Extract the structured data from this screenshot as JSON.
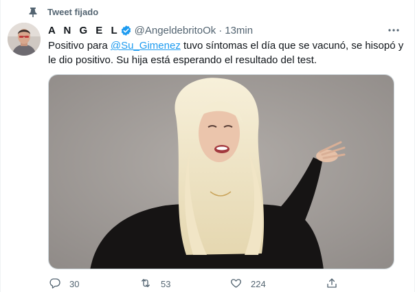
{
  "pinned": {
    "label": "Tweet fijado",
    "icon": "pin-icon"
  },
  "author": {
    "display_name": "A N G E L",
    "handle": "@AngeldebritoOk",
    "separator": "·",
    "time": "13min",
    "verified_icon": "verified-badge-icon"
  },
  "tweet": {
    "text_before": "Positivo para ",
    "mention": "@Su_Gimenez",
    "text_after": " tuvo síntomas el día que se vacunó, se hisopó y le dio positivo. Su hija está esperando el resultado del test."
  },
  "actions": {
    "replies": "30",
    "retweets": "53",
    "likes": "224"
  },
  "colors": {
    "accent": "#1d9bf0",
    "muted": "#536471",
    "text": "#0f1419",
    "photo_background": "#a29c98"
  }
}
